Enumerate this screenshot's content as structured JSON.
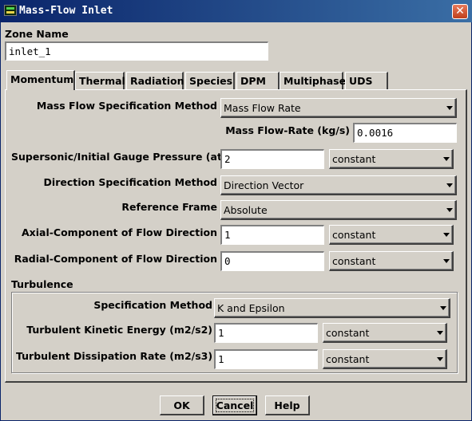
{
  "window": {
    "title": "Mass-Flow Inlet",
    "close_symbol": "✕"
  },
  "zone": {
    "label": "Zone Name",
    "value": "inlet_1"
  },
  "tabs": [
    {
      "label": "Momentum"
    },
    {
      "label": "Thermal"
    },
    {
      "label": "Radiation"
    },
    {
      "label": "Species"
    },
    {
      "label": "DPM"
    },
    {
      "label": "Multiphase"
    },
    {
      "label": "UDS"
    }
  ],
  "momentum": {
    "mass_flow_spec_label": "Mass Flow Specification Method",
    "mass_flow_spec_value": "Mass Flow Rate",
    "mass_flow_rate_label": "Mass Flow-Rate (kg/s)",
    "mass_flow_rate_value": "0.0016",
    "pressure_label": "Supersonic/Initial Gauge Pressure (atm)",
    "pressure_value": "2",
    "pressure_method": "constant",
    "direction_spec_label": "Direction Specification Method",
    "direction_spec_value": "Direction Vector",
    "reference_frame_label": "Reference Frame",
    "reference_frame_value": "Absolute",
    "axial_label": "Axial-Component of Flow Direction",
    "axial_value": "1",
    "axial_method": "constant",
    "radial_label": "Radial-Component of Flow Direction",
    "radial_value": "0",
    "radial_method": "constant"
  },
  "turbulence": {
    "group_label": "Turbulence",
    "spec_label": "Specification Method",
    "spec_value": "K and Epsilon",
    "tke_label": "Turbulent Kinetic Energy (m2/s2)",
    "tke_value": "1",
    "tke_method": "constant",
    "tdr_label": "Turbulent Dissipation Rate (m2/s3)",
    "tdr_value": "1",
    "tdr_method": "constant"
  },
  "buttons": {
    "ok": "OK",
    "cancel": "Cancel",
    "help": "Help"
  },
  "colors": {
    "title_bar": "#0a246a",
    "dialog_bg": "#d4d0c8",
    "close_button": "#c0401c"
  }
}
